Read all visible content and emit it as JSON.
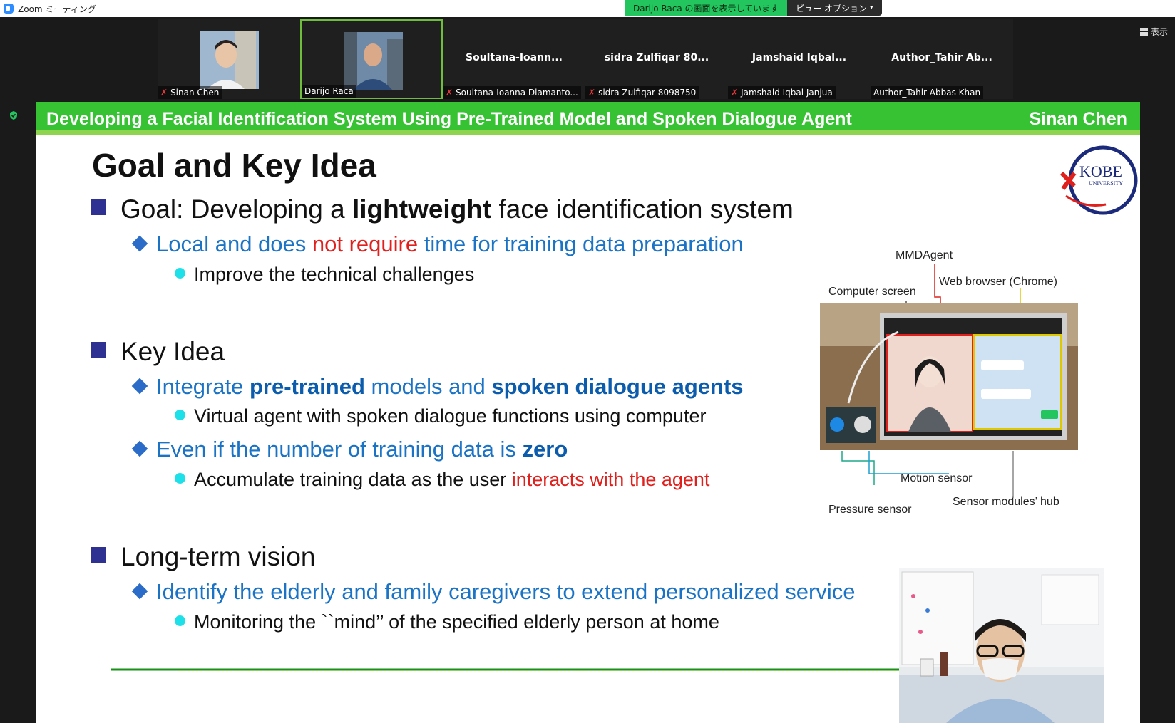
{
  "window": {
    "title": "Zoom ミーティング"
  },
  "share_banner": {
    "text": "Darijo  Raca の画面を表示しています",
    "view_options": "ビュー オプション"
  },
  "view_toggle": {
    "label": "表示"
  },
  "participants": [
    {
      "name": "Sinan Chen",
      "display": "",
      "muted": true,
      "has_video": true
    },
    {
      "name": "Darijo Raca",
      "display": "",
      "muted": false,
      "has_video": true,
      "active_speaker": true
    },
    {
      "name": "Soultana-Ioanna Diamanto...",
      "display": "Soultana-Ioann...",
      "muted": true
    },
    {
      "name": "sidra Zulfiqar 8098750",
      "display": "sidra Zulfiqar 80...",
      "muted": true
    },
    {
      "name": "Jamshaid Iqbal Janjua",
      "display": "Jamshaid Iqbal...",
      "muted": true
    },
    {
      "name": "Author_Tahir Abbas Khan",
      "display": "Author_Tahir Ab...",
      "muted": false
    }
  ],
  "slide": {
    "header_title": "Developing a Facial Identification System Using Pre-Trained Model and Spoken Dialogue Agent",
    "header_author": "Sinan Chen",
    "title": "Goal and Key Idea",
    "logo": {
      "name": "KOBE",
      "sub": "UNIVERSITY"
    },
    "goal": {
      "prefix": "Goal: Developing a ",
      "bold": "lightweight",
      "suffix": " face identification system",
      "sub1": {
        "a": "Local and does ",
        "red": "not require",
        "b": " time for training data preparation"
      },
      "sub1_detail": "Improve the technical challenges"
    },
    "key_idea": {
      "label": "Key Idea",
      "sub1": {
        "a": "Integrate ",
        "b1": "pre-trained",
        "c": " models and ",
        "b2": "spoken dialogue agents"
      },
      "sub1_detail": "Virtual agent with spoken dialogue functions using computer",
      "sub2": {
        "a": "Even if the number of training data is ",
        "b": "zero"
      },
      "sub2_detail": {
        "a": "Accumulate training data as the user ",
        "red": "interacts with the agent"
      }
    },
    "vision": {
      "label": "Long-term vision",
      "sub1": "Identify the elderly and family caregivers to extend personalized service",
      "sub1_detail": "Monitoring the ``mind’’ of the specified elderly person at home"
    },
    "figure": {
      "labels": {
        "mmdagent": "MMDAgent",
        "computer_screen": "Computer screen",
        "web_browser": "Web browser (Chrome)",
        "motion_sensor": "Motion sensor",
        "sensor_hub": "Sensor modules’ hub",
        "pressure_sensor": "Pressure sensor"
      }
    }
  },
  "colors": {
    "header_green": "#36c233",
    "bullet_navy": "#2e3192",
    "link_blue": "#1a73c5",
    "red": "#e0201c",
    "cyan": "#1ee0e8"
  }
}
